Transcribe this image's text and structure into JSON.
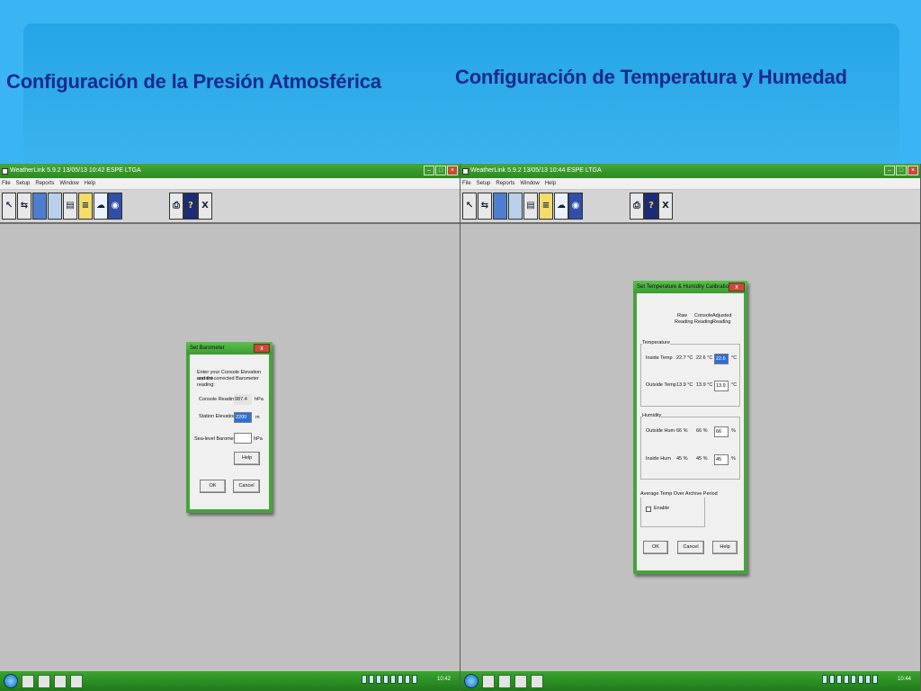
{
  "slide": {
    "heading_left": "Configuración de la Presión Atmosférica",
    "heading_right": "Configuración de Temperatura y Humedad"
  },
  "left_window": {
    "title": "WeatherLink 5.9.2  13/05/13  10:42  ESPE LTGA",
    "menu": [
      "File",
      "Setup",
      "Reports",
      "Window",
      "Help"
    ],
    "clock": "10:42",
    "dialog": {
      "title": "Set Barometer",
      "instructions_line1": "Enter your Console Elevation and the",
      "instructions_line2": "current corrected Barometer reading:",
      "console_reading_label": "Console Reading:",
      "console_reading_value": "987.4",
      "console_reading_unit": "hPa",
      "station_elevation_label": "Station Elevation:",
      "station_elevation_value": "2200",
      "station_elevation_unit": "m",
      "sea_level_label": "Sea-level Barometer:",
      "sea_level_value": "",
      "sea_level_unit": "hPa",
      "help": "Help",
      "ok": "OK",
      "cancel": "Cancel"
    }
  },
  "right_window": {
    "title": "WeatherLink 5.9.2  13/05/13  10:44  ESPE LTGA",
    "menu": [
      "File",
      "Setup",
      "Reports",
      "Window",
      "Help"
    ],
    "clock": "10:44",
    "dialog": {
      "title": "Set Temperature & Humidity Calibration",
      "col_raw_1": "Raw",
      "col_raw_2": "Reading",
      "col_console_1": "Console",
      "col_console_2": "Reading",
      "col_adjusted_1": "Adjusted",
      "col_adjusted_2": "Reading",
      "temperature_group": "Temperature",
      "inside_temp_label": "Inside Temp",
      "inside_temp_raw": "22.7 °C",
      "inside_temp_console": "22.6 °C",
      "inside_temp_adjusted": "22.6",
      "inside_temp_unit": "°C",
      "outside_temp_label": "Outside Temp",
      "outside_temp_raw": "13.9 °C",
      "outside_temp_console": "13.9 °C",
      "outside_temp_adjusted": "13.9",
      "outside_temp_unit": "°C",
      "humidity_group": "Humidity",
      "outside_hum_label": "Outside Hum",
      "outside_hum_raw": "66 %",
      "outside_hum_console": "66 %",
      "outside_hum_adjusted": "66",
      "outside_hum_unit": "%",
      "inside_hum_label": "Inside Hum",
      "inside_hum_raw": "45 %",
      "inside_hum_console": "45 %",
      "inside_hum_adjusted": "45",
      "inside_hum_unit": "%",
      "archive_group": "Average Temp Over Archive Period",
      "enable_label": "Enable",
      "ok": "OK",
      "cancel": "Cancel",
      "help": "Help"
    }
  },
  "toolbar": {
    "help_glyph": "?",
    "close_glyph": "X"
  }
}
